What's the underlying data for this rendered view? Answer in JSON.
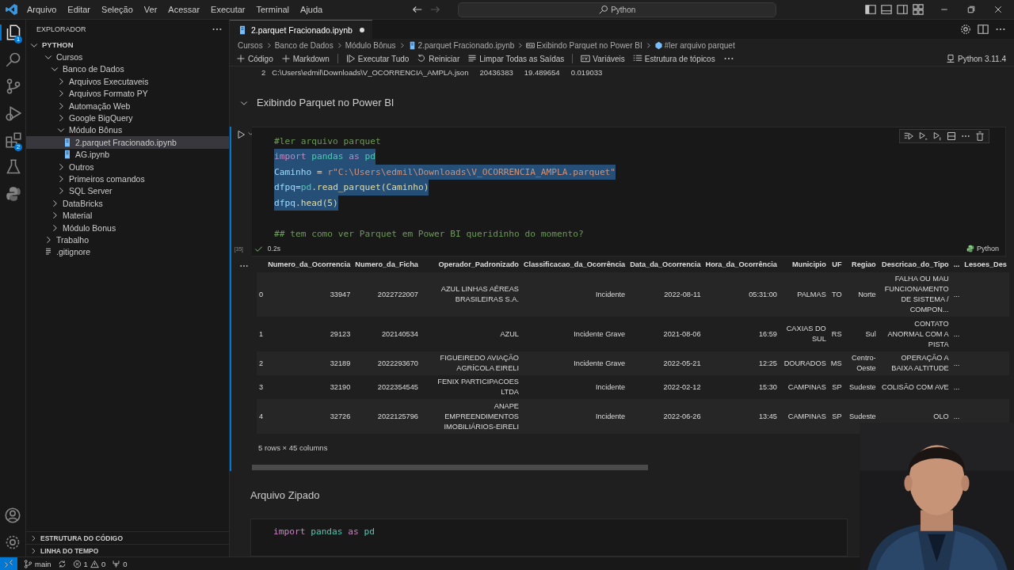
{
  "menu": [
    "Arquivo",
    "Editar",
    "Seleção",
    "Ver",
    "Acessar",
    "Executar",
    "Terminal",
    "Ajuda"
  ],
  "search": {
    "value": "Python"
  },
  "activity": [
    {
      "badge": "1",
      "selected": true
    },
    {
      "selected": false
    },
    {
      "selected": false
    },
    {
      "selected": false
    },
    {
      "badge": "2",
      "selected": false
    },
    {
      "selected": false
    },
    {
      "selected": false
    }
  ],
  "sidebar": {
    "title": "EXPLORADOR",
    "root": "PYTHON",
    "items": [
      {
        "label": "Cursos",
        "kind": "folder",
        "expanded": true,
        "selected": false,
        "children": [
          {
            "label": "Banco de Dados",
            "kind": "folder",
            "expanded": true,
            "selected": false,
            "children": [
              {
                "label": "Arquivos Executaveis",
                "kind": "folder",
                "expanded": false,
                "selected": false
              },
              {
                "label": "Arquivos Formato PY",
                "kind": "folder",
                "expanded": false,
                "selected": false
              },
              {
                "label": "Automação Web",
                "kind": "folder",
                "expanded": false,
                "selected": false
              },
              {
                "label": "Google BigQuery",
                "kind": "folder",
                "expanded": false,
                "selected": false
              },
              {
                "label": "Módulo Bônus",
                "kind": "folder",
                "expanded": true,
                "selected": false,
                "children": [
                  {
                    "label": "2.parquet Fracionado.ipynb",
                    "kind": "notebook",
                    "selected": true
                  },
                  {
                    "label": "AG.ipynb",
                    "kind": "notebook",
                    "selected": false
                  }
                ]
              },
              {
                "label": "Outros",
                "kind": "folder",
                "expanded": false,
                "selected": false
              },
              {
                "label": "Primeiros comandos",
                "kind": "folder",
                "expanded": false,
                "selected": false
              },
              {
                "label": "SQL Server",
                "kind": "folder",
                "expanded": false,
                "selected": false
              }
            ]
          },
          {
            "label": "DataBricks",
            "kind": "folder",
            "expanded": false,
            "selected": false
          },
          {
            "label": "Material",
            "kind": "folder",
            "expanded": false,
            "selected": false
          },
          {
            "label": "Módulo Bonus",
            "kind": "folder",
            "expanded": false,
            "selected": false
          }
        ]
      },
      {
        "label": "Trabalho",
        "kind": "folder",
        "expanded": false,
        "selected": false
      },
      {
        "label": ".gitignore",
        "kind": "file",
        "selected": false
      }
    ],
    "panels": [
      "ESTRUTURA DO CÓDIGO",
      "LINHA DO TEMPO"
    ]
  },
  "tab": {
    "label": "2.parquet Fracionado.ipynb",
    "dirty": true
  },
  "breadcrumbs": [
    {
      "label": "Cursos",
      "kind": "folder"
    },
    {
      "label": "Banco de Dados",
      "kind": "folder"
    },
    {
      "label": "Módulo Bônus",
      "kind": "folder"
    },
    {
      "label": "2.parquet Fracionado.ipynb",
      "kind": "notebook"
    },
    {
      "label": "Exibindo Parquet no Power BI",
      "kind": "markdown"
    },
    {
      "label": "#ler arquivo parquet",
      "kind": "cell"
    }
  ],
  "toolbar": [
    "Código",
    "Markdown",
    "Executar Tudo",
    "Reiniciar",
    "Limpar Todas as Saídas",
    "Variáveis",
    "Estrutura de tópicos"
  ],
  "kernel": "Python 3.11.4",
  "prev_output": [
    "2",
    "C:\\Users\\edmil\\Downloads\\V_OCORRENCIA_AMPLA.json",
    "20436383",
    "19.489654",
    "0.019033"
  ],
  "section": {
    "title": "Exibindo Parquet no Power BI",
    "expanded": true
  },
  "cell": {
    "count": "[35]",
    "time": "0.2s",
    "language": "Python",
    "lines": [
      {
        "selected": false,
        "tokens": [
          {
            "t": "#ler arquivo parquet",
            "color": "#6a9955"
          }
        ]
      },
      {
        "selected": true,
        "tokens": [
          {
            "t": "import",
            "color": "#c586c0"
          },
          {
            "t": " pandas ",
            "color": "#4ec9b0"
          },
          {
            "t": "as",
            "color": "#c586c0"
          },
          {
            "t": " pd",
            "color": "#4ec9b0"
          }
        ]
      },
      {
        "selected": true,
        "tokens": [
          {
            "t": "Caminho",
            "color": "#9cdcfe"
          },
          {
            "t": " = ",
            "color": "#d4d4d4"
          },
          {
            "t": "r\"C:\\Users\\edmil\\Downloads\\V_OCORRENCIA_AMPLA.parquet\"",
            "color": "#ce9178"
          }
        ]
      },
      {
        "selected": true,
        "tokens": [
          {
            "t": "dfpq",
            "color": "#9cdcfe"
          },
          {
            "t": "=",
            "color": "#d4d4d4"
          },
          {
            "t": "pd",
            "color": "#4ec9b0"
          },
          {
            "t": ".read_parquet(Caminho)",
            "color": "#dcdcaa"
          }
        ]
      },
      {
        "selected": true,
        "tokens": [
          {
            "t": "dfpq",
            "color": "#9cdcfe"
          },
          {
            "t": ".head(5)",
            "color": "#dcdcaa"
          }
        ]
      },
      {
        "selected": false,
        "tokens": [
          {
            "t": "## tem como ver Parquet em Power BI queridinho do momento?",
            "color": "#6a9955"
          }
        ]
      }
    ]
  },
  "table": {
    "columns": [
      "",
      "Numero_da_Ocorrencia",
      "Numero_da_Ficha",
      "Operador_Padronizado",
      "Classificacao_da_Ocorrência",
      "Data_da_Ocorrencia",
      "Hora_da_Ocorrência",
      "Municipio",
      "UF",
      "Regiao",
      "Descricao_do_Tipo",
      "...",
      "Lesoes_Des"
    ],
    "rows": [
      [
        "0",
        "33947",
        "2022722007",
        "AZUL LINHAS AÉREAS BRASILEIRAS S.A.",
        "Incidente",
        "2022-08-11",
        "05:31:00",
        "PALMAS",
        "TO",
        "Norte",
        "FALHA OU MAU FUNCIONAMENTO DE SISTEMA / COMPON...",
        "..."
      ],
      [
        "1",
        "29123",
        "202140534",
        "AZUL",
        "Incidente Grave",
        "2021-08-06",
        "16:59",
        "CAXIAS DO SUL",
        "RS",
        "Sul",
        "CONTATO ANORMAL COM A PISTA",
        "..."
      ],
      [
        "2",
        "32189",
        "2022293670",
        "FIGUEIREDO AVIAÇÃO AGRÍCOLA EIRELI",
        "Incidente Grave",
        "2022-05-21",
        "12:25",
        "DOURADOS",
        "MS",
        "Centro-Oeste",
        "OPERAÇÃO A BAIXA ALTITUDE",
        "..."
      ],
      [
        "3",
        "32190",
        "2022354545",
        "FENIX PARTICIPACOES LTDA",
        "Incidente",
        "2022-02-12",
        "15:30",
        "CAMPINAS",
        "SP",
        "Sudeste",
        "COLISÃO COM AVE",
        "..."
      ],
      [
        "4",
        "32726",
        "2022125796",
        "ANAPE EMPREENDIMENTOS IMOBILIÁRIOS-EIRELI",
        "Incidente",
        "2022-06-26",
        "13:45",
        "CAMPINAS",
        "SP",
        "Sudeste",
        "OLO",
        "..."
      ]
    ],
    "summary": "5 rows × 45 columns"
  },
  "next_section": "Arquivo Zipado",
  "next_cell": [
    {
      "t": "import",
      "color": "#c586c0"
    },
    {
      "t": " pandas ",
      "color": "#4ec9b0"
    },
    {
      "t": "as",
      "color": "#c586c0"
    },
    {
      "t": " pd",
      "color": "#4ec9b0"
    }
  ],
  "status": {
    "branch": "main",
    "errors": "1",
    "warnings": "0",
    "ports": "0"
  },
  "webcam": {
    "kind": "picture"
  }
}
